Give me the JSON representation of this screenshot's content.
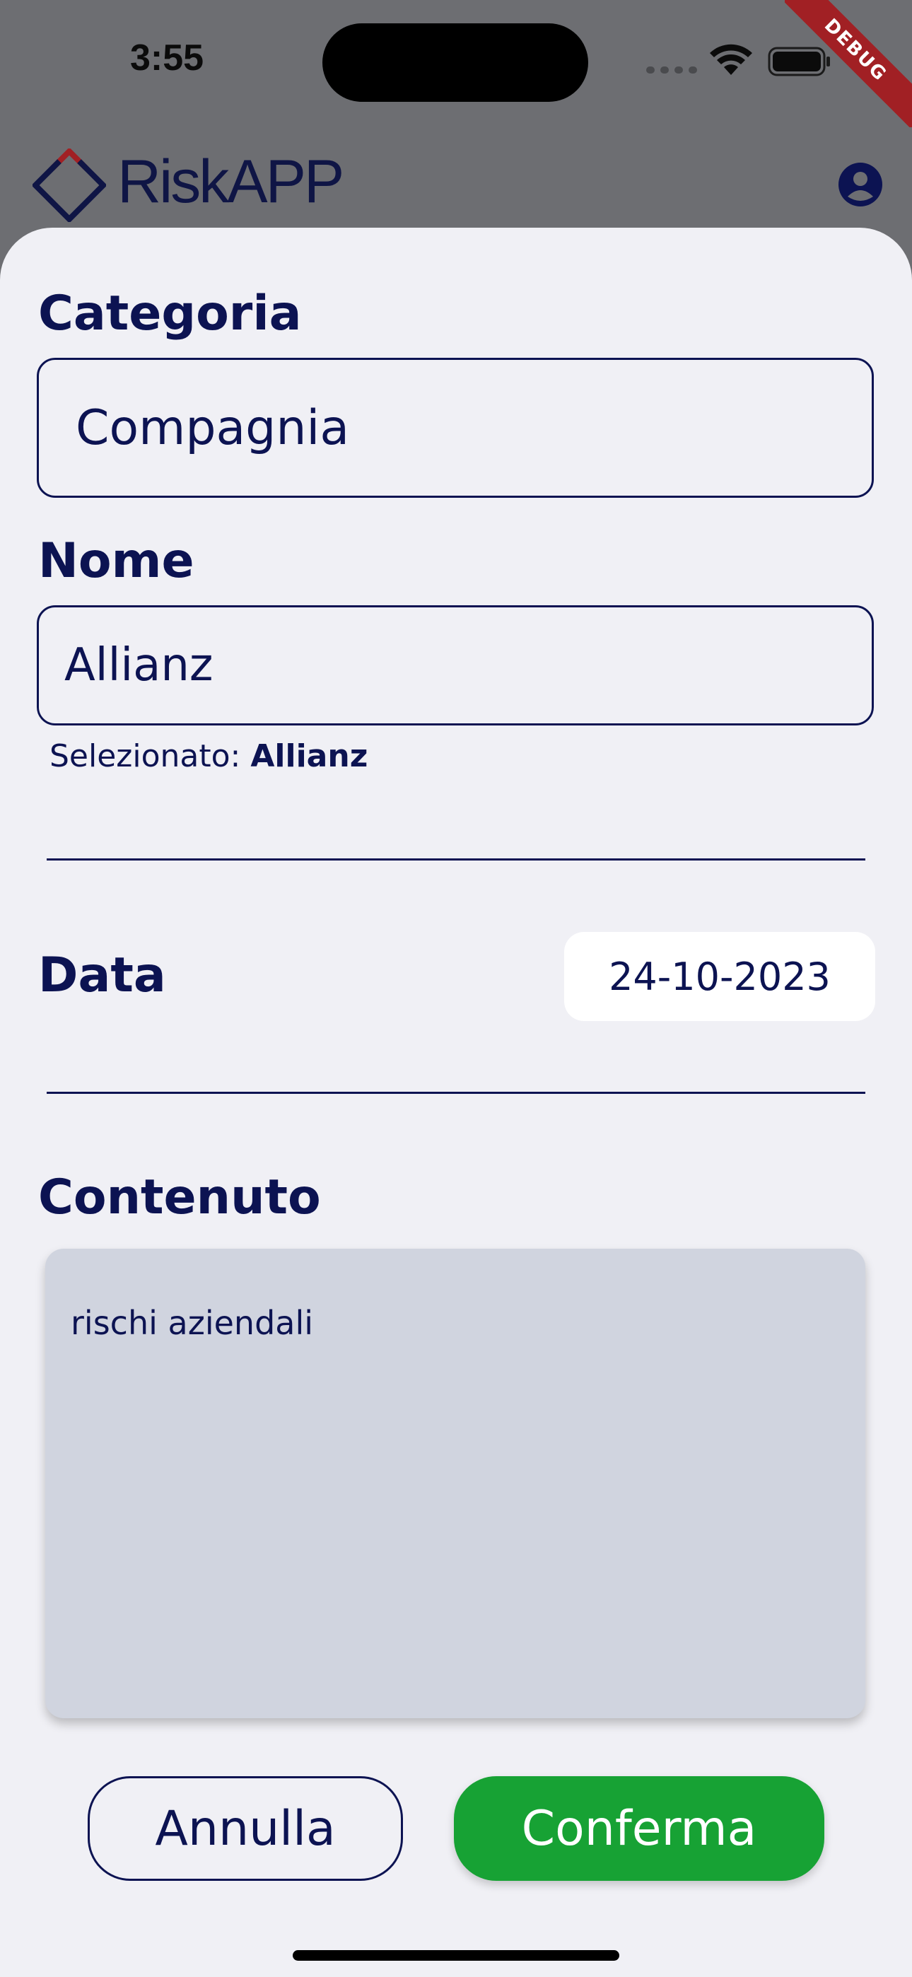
{
  "status_bar": {
    "time": "3:55",
    "debug_banner": "DEBUG"
  },
  "header": {
    "app_name": "RiskAPP"
  },
  "form": {
    "category": {
      "label": "Categoria",
      "value": "Compagnia"
    },
    "name": {
      "label": "Nome",
      "value": "Allianz",
      "selected_prefix": "Selezionato: ",
      "selected_value": "Allianz"
    },
    "date": {
      "label": "Data",
      "value": "24-10-2023"
    },
    "content": {
      "label": "Contenuto",
      "value": "rischi aziendali"
    }
  },
  "actions": {
    "cancel_label": "Annulla",
    "confirm_label": "Conferma"
  },
  "colors": {
    "primary": "#0c1352",
    "confirm": "#17a234",
    "logo_accent": "#a12024"
  }
}
